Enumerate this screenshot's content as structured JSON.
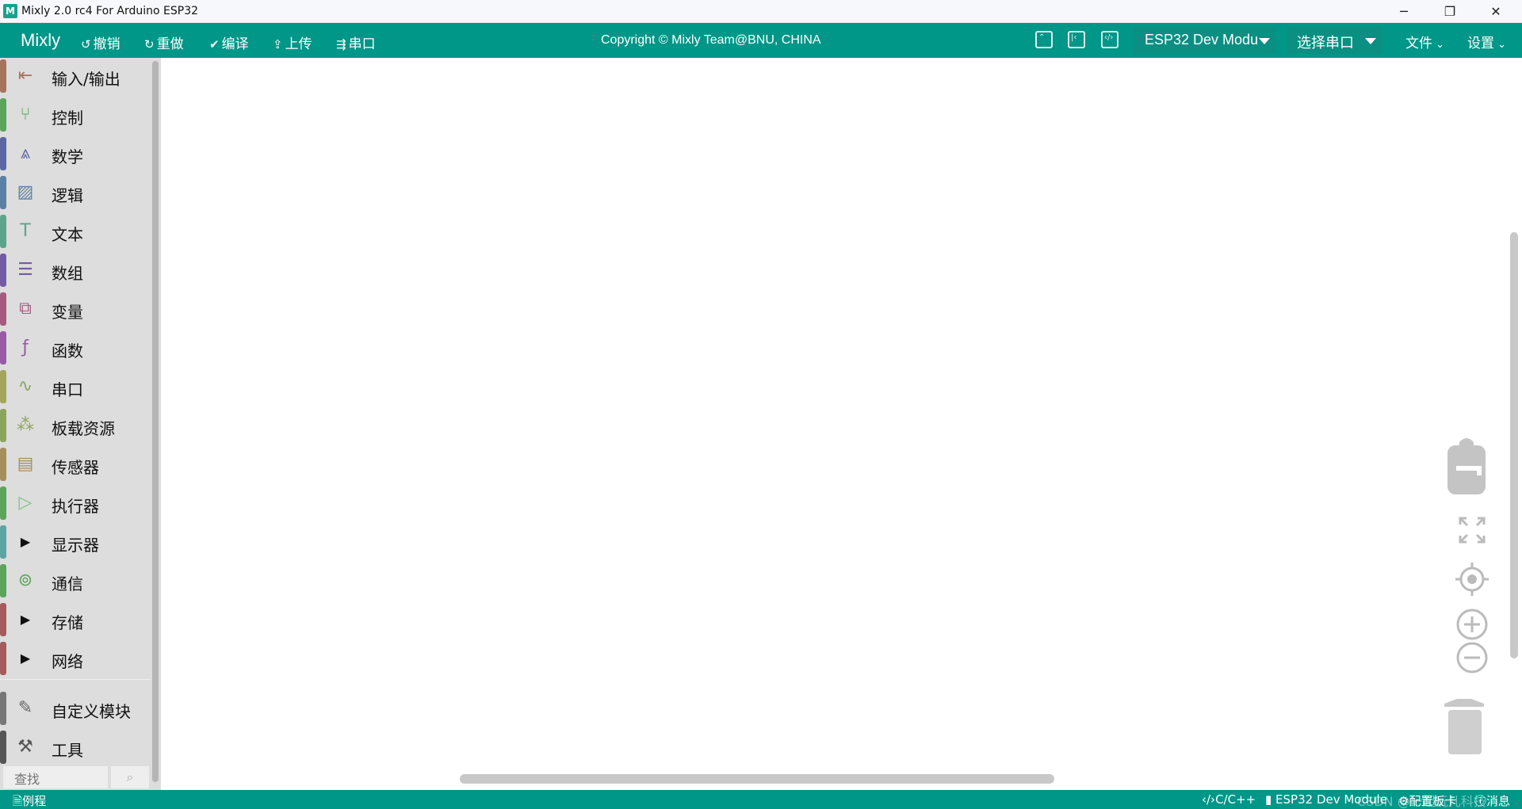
{
  "window": {
    "title": "Mixly 2.0 rc4 For Arduino ESP32",
    "icon_letter": "M",
    "controls": {
      "minimize": "─",
      "restore": "❐",
      "close": "✕"
    }
  },
  "toolbar": {
    "brand": "Mixly",
    "undo": "撤销",
    "redo": "重做",
    "compile": "编译",
    "upload": "上传",
    "serial": "串口",
    "copyright": "Copyright © Mixly Team@BNU, CHINA",
    "board": "ESP32 Dev Modu",
    "port": "选择串口",
    "file_menu": "文件",
    "settings_menu": "设置"
  },
  "sidebar": {
    "categories": [
      {
        "label": "输入/输出",
        "color": "#a5745b",
        "icon_color": "#a5745b",
        "icon": "io-icon"
      },
      {
        "label": "控制",
        "color": "#5ba55b",
        "icon_color": "#5ba55b",
        "icon": "control-icon"
      },
      {
        "label": "数学",
        "color": "#5b67a5",
        "icon_color": "#5b67a5",
        "icon": "math-icon"
      },
      {
        "label": "逻辑",
        "color": "#5b80a5",
        "icon_color": "#5b80a5",
        "icon": "logic-icon"
      },
      {
        "label": "文本",
        "color": "#5ba58c",
        "icon_color": "#5ba58c",
        "icon": "text-icon"
      },
      {
        "label": "数组",
        "color": "#745ba5",
        "icon_color": "#745ba5",
        "icon": "array-icon"
      },
      {
        "label": "变量",
        "color": "#a55b80",
        "icon_color": "#a55b80",
        "icon": "variable-icon"
      },
      {
        "label": "函数",
        "color": "#995ba5",
        "icon_color": "#995ba5",
        "icon": "function-icon"
      },
      {
        "label": "串口",
        "color": "#a5a55b",
        "icon_color": "#8aa55b",
        "icon": "serial-icon"
      },
      {
        "label": "板载资源",
        "color": "#8ba55b",
        "icon_color": "#8ba55b",
        "icon": "board-icon"
      },
      {
        "label": "传感器",
        "color": "#a5905b",
        "icon_color": "#a5905b",
        "icon": "sensor-icon"
      },
      {
        "label": "执行器",
        "color": "#5ba55b",
        "icon_color": "#7bc47b",
        "icon": "actuator-icon"
      },
      {
        "label": "显示器",
        "color": "#5ba5a5",
        "icon_color": "#111111",
        "icon": "expand-triangle-icon"
      },
      {
        "label": "通信",
        "color": "#5ba55b",
        "icon_color": "#5ba55b",
        "icon": "antenna-icon"
      },
      {
        "label": "存储",
        "color": "#a55b5b",
        "icon_color": "#111111",
        "icon": "expand-triangle-icon"
      },
      {
        "label": "网络",
        "color": "#a55b5b",
        "icon_color": "#111111",
        "icon": "expand-triangle-icon"
      },
      {
        "label": "自定义模块",
        "color": "#777777",
        "icon_color": "#666666",
        "icon": "custom-icon"
      },
      {
        "label": "工具",
        "color": "#555555",
        "icon_color": "#555555",
        "icon": "tools-icon"
      }
    ],
    "search_placeholder": "查找"
  },
  "statusbar": {
    "examples": "例程",
    "language": "C/C++",
    "board": "ESP32 Dev Module",
    "config": "配置板卡",
    "message": "消息",
    "watermark": "CSDN @一起玩儿科技"
  }
}
